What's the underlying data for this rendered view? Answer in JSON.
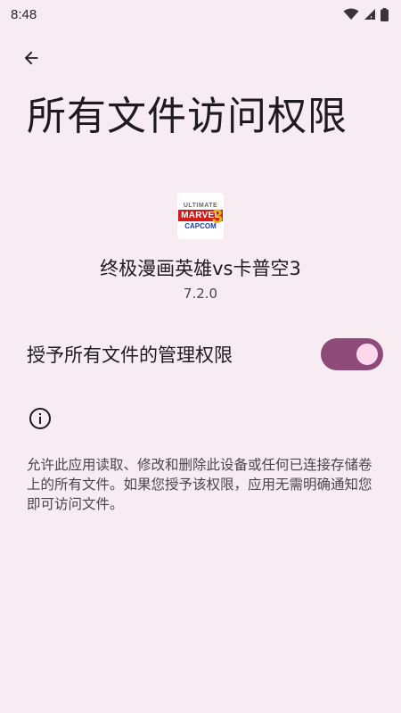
{
  "status_bar": {
    "time": "8:48",
    "icons": [
      "wifi-icon",
      "cellular-signal-icon",
      "battery-icon"
    ]
  },
  "header": {
    "back_icon": "arrow-back-icon",
    "title": "所有文件访问权限"
  },
  "app": {
    "logo_icon": "ultimate-marvel-vs-capcom-3-logo",
    "logo_lines": [
      "ULTIMATE",
      "MARVEL",
      "CAPCOM",
      "3"
    ],
    "name": "终极漫画英雄vs卡普空3",
    "version": "7.2.0"
  },
  "permission": {
    "label": "授予所有文件的管理权限",
    "enabled": true
  },
  "info": {
    "icon": "info-icon",
    "description": "允许此应用读取、修改和删除此设备或任何已连接存储卷上的所有文件。如果您授予该权限，应用无需明确通知您即可访问文件。"
  },
  "colors": {
    "background": "#f7ecf1",
    "toggle_track": "#8e4a78",
    "toggle_thumb": "#ffd8ee",
    "text_primary": "#1f1a1d",
    "text_secondary": "#4e4449"
  }
}
